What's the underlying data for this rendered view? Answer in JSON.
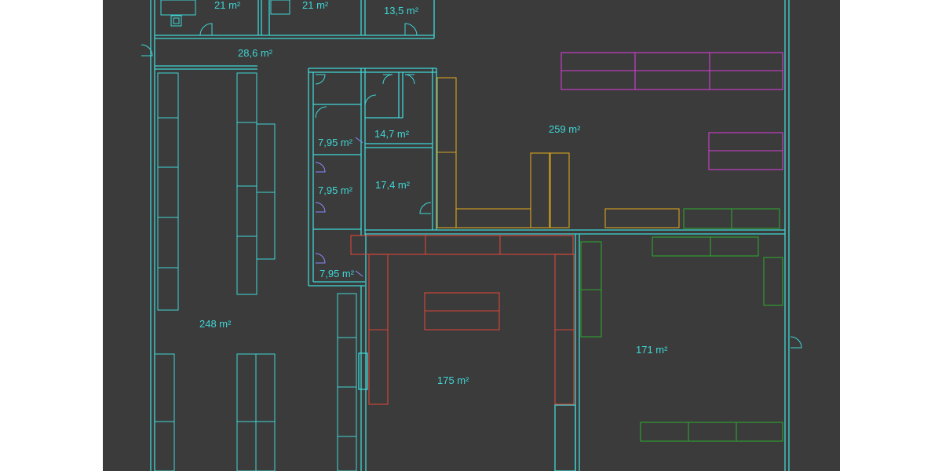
{
  "plan": {
    "title": "",
    "rooms": [
      {
        "label": "21 m²"
      },
      {
        "label": "21 m²"
      },
      {
        "label": "13,5 m²"
      },
      {
        "label": "28,6 m²"
      },
      {
        "label": "259 m²"
      },
      {
        "label": "14,7 m²"
      },
      {
        "label": "7,95 m²"
      },
      {
        "label": "7,95 m²"
      },
      {
        "label": "17,4 m²"
      },
      {
        "label": "7,95 m²"
      },
      {
        "label": "248 m²"
      },
      {
        "label": "175 m²"
      },
      {
        "label": "171 m²"
      }
    ],
    "colors": {
      "background": "#3b3b3b",
      "walls": "#3fd6d6",
      "magenta_fixtures": "#d13fd1",
      "orange_fixtures": "#d6a21f",
      "red_fixtures": "#d9463a",
      "green_fixtures": "#2fa32f"
    }
  }
}
